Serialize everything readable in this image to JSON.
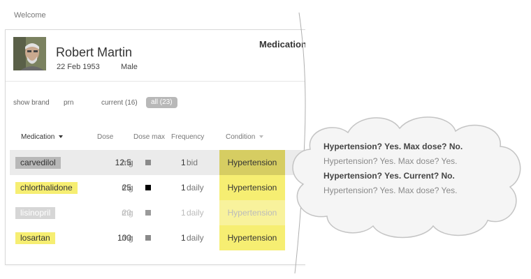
{
  "header": {
    "welcome": "Welcome"
  },
  "patient": {
    "name": "Robert Martin",
    "dob": "22 Feb 1953",
    "sex": "Male"
  },
  "tab_title": "Medication",
  "filters": {
    "show_brand": "show brand",
    "prn": "prn",
    "current": "current (16)",
    "all": "all (23)"
  },
  "columns": {
    "medication": "Medication",
    "dose": "Dose",
    "dose_max": "Dose max",
    "frequency": "Frequency",
    "condition": "Condition"
  },
  "rows": [
    {
      "drug": "carvedilol",
      "dose": "12.5",
      "unit": "mg",
      "freq_n": "1",
      "freq_u": "bid",
      "condition": "Hypertension"
    },
    {
      "drug": "chlorthalidone",
      "dose": "25",
      "unit": "mg",
      "freq_n": "1",
      "freq_u": "daily",
      "condition": "Hypertension"
    },
    {
      "drug": "lisinopril",
      "dose": "20",
      "unit": "mg",
      "freq_n": "1",
      "freq_u": "daily",
      "condition": "Hypertension"
    },
    {
      "drug": "losartan",
      "dose": "100",
      "unit": "mg",
      "freq_n": "1",
      "freq_u": "daily",
      "condition": "Hypertension"
    }
  ],
  "cloud": {
    "line1": "Hypertension? Yes. Max dose? No.",
    "line2": "Hypertension? Yes. Max dose? Yes.",
    "line3": "Hypertension? Yes. Current? No.",
    "line4": "Hypertension? Yes. Max dose? Yes."
  },
  "colors": {
    "highlight_yellow": "#f6ee72",
    "selected_row": "#ebebeb",
    "pill_grey": "#b8b8b8"
  }
}
